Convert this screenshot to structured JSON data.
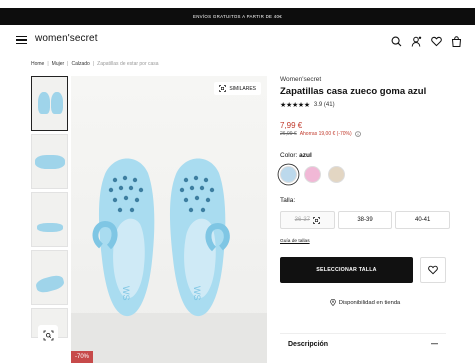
{
  "topbar": {
    "text": "ENVÍOS GRATUITOS A PARTIR DE 40€"
  },
  "header": {
    "logo": "women'secret",
    "icons": [
      "menu-icon",
      "search-icon",
      "account-icon",
      "heart-icon",
      "bag-icon"
    ]
  },
  "breadcrumb": {
    "items": [
      "Home",
      "Mujer",
      "Calzado",
      "Zapatillas de estar por casa"
    ],
    "separator": "|"
  },
  "gallery": {
    "similar_label": "SIMILARES",
    "discount_badge": "-70%"
  },
  "product": {
    "brand": "Women'secret",
    "title": "Zapatillas casa zueco goma azul",
    "stars": "★★★★★",
    "rating": "3.9 (41)",
    "price": "7,99 €",
    "old_price": "26,99 €",
    "saving": "Ahorras 19,00 € (-70%)",
    "color_label": "Color:",
    "color_name": "azul",
    "swatch_colors": [
      "#bcd9ec",
      "#f1b8d6",
      "#e3d6c3"
    ],
    "size_label": "Talla:",
    "sizes": [
      "36-37",
      "38-39",
      "40-41"
    ],
    "size_guide": "Guía de tallas",
    "cta": "SELECCIONAR TALLA",
    "availability": "Disponibilidad en tienda",
    "description_label": "Descripción",
    "description_toggle": "—"
  },
  "colors": {
    "accent_red": "#c0392b",
    "cta_bg": "#111111",
    "clog_blue": "#9fd4ea"
  }
}
